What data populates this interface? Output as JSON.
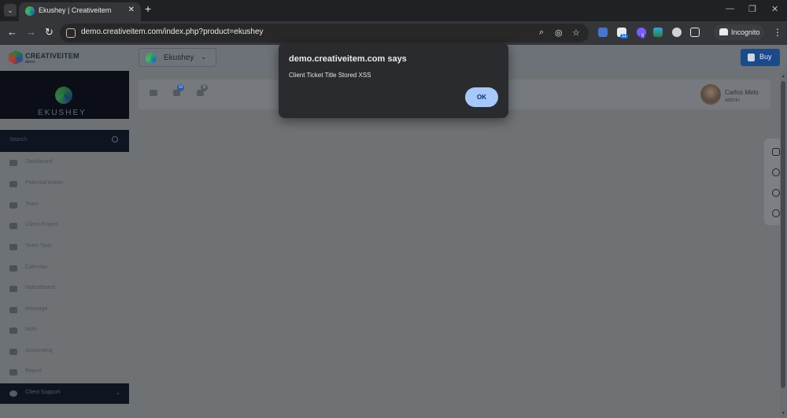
{
  "browser": {
    "tab_title": "Ekushey | Creativeitem",
    "new_tab": "+",
    "url": "demo.creativeitem.com/index.php?product=ekushey",
    "extension_badges": [
      "11",
      "6"
    ],
    "incognito_label": "Incognito"
  },
  "app": {
    "logo_text": "CREATIVEITEM",
    "logo_subtext": "demo",
    "product_selector": "Ekushey",
    "buy_label": "Buy",
    "brand_text": "EKUSHEY",
    "search_placeholder": "Search",
    "nav_items": [
      {
        "label": "Dashboard"
      },
      {
        "label": "Potential Artists"
      },
      {
        "label": "Team"
      },
      {
        "label": "Client Project"
      },
      {
        "label": "Team Task"
      },
      {
        "label": "Calendar"
      },
      {
        "label": "Noticeboard"
      },
      {
        "label": "Message"
      },
      {
        "label": "Note"
      },
      {
        "label": "Accounting"
      },
      {
        "label": "Report"
      },
      {
        "label": "Client Support"
      }
    ],
    "header_badges": [
      "10",
      "2"
    ],
    "user": {
      "name": "Carlos Melo",
      "role": "admin"
    }
  },
  "dialog": {
    "title": "demo.creativeitem.com says",
    "message": "Client Ticket Title Stored XSS",
    "ok_label": "OK"
  },
  "colors": {
    "dialog_bg": "#2a2b2e",
    "ok_button": "#a8c7fa",
    "buy_button": "#1b4a8c",
    "sidebar_active": "#0f1421"
  }
}
